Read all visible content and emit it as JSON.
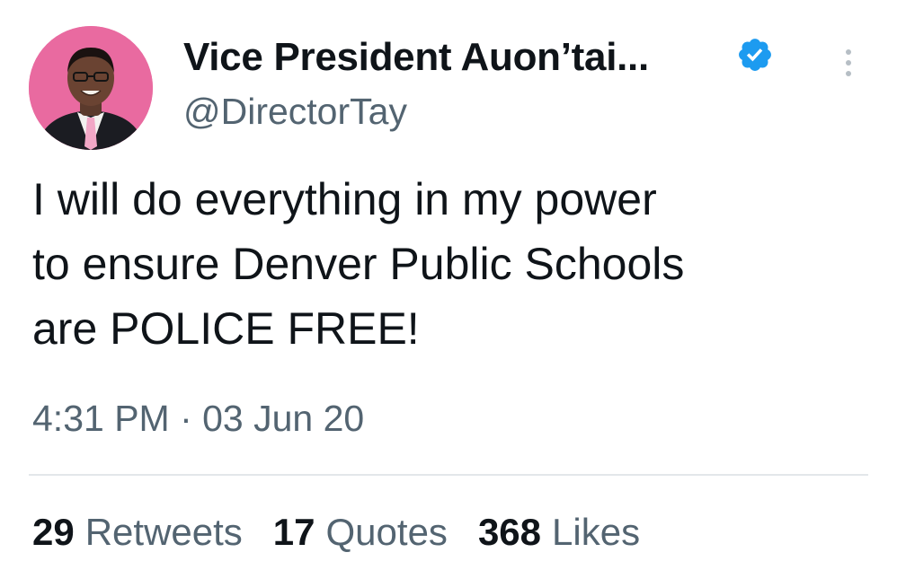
{
  "author": {
    "display_name": "Vice President Auon’tai...",
    "handle": "@DirectorTay",
    "verified": true,
    "avatar_icon": "profile-photo",
    "verified_icon": "verified-badge-icon"
  },
  "tweet": {
    "lines": [
      "I will do everything in my power",
      "to ensure Denver Public Schools",
      "are POLICE FREE!"
    ],
    "timestamp": "4:31 PM · 03 Jun 20"
  },
  "stats": {
    "retweets_count": "29",
    "retweets_label": "Retweets",
    "quotes_count": "17",
    "quotes_label": "Quotes",
    "likes_count": "368",
    "likes_label": "Likes"
  },
  "colors": {
    "text_primary": "#0f1419",
    "text_secondary": "#536471",
    "verified_blue": "#1d9bf0",
    "avatar_background": "#e96aa0",
    "divider": "#e3e7ea"
  }
}
